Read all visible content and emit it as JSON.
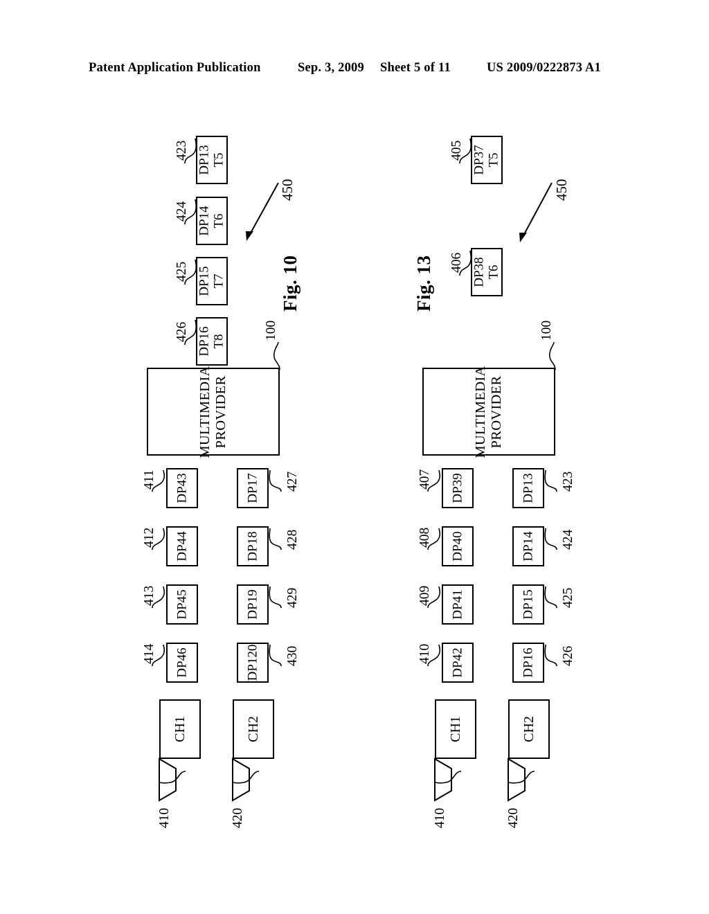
{
  "header": {
    "publication": "Patent Application Publication",
    "date": "Sep. 3, 2009",
    "sheet": "Sheet 5 of 11",
    "patent_number": "US 2009/0222873 A1"
  },
  "figures": [
    {
      "caption": "Fig. 10",
      "provider": {
        "line1": "MULTIMEDIA",
        "line2": "PROVIDER",
        "ref": "100"
      },
      "group_ref": "450",
      "time_boxes": [
        {
          "dp": "DP13",
          "t": "T5",
          "ref": "423"
        },
        {
          "dp": "DP14",
          "t": "T6",
          "ref": "424"
        },
        {
          "dp": "DP15",
          "t": "T7",
          "ref": "425"
        },
        {
          "dp": "DP16",
          "t": "T8",
          "ref": "426"
        }
      ],
      "row1": [
        {
          "dp": "DP43",
          "ref": "411"
        },
        {
          "dp": "DP44",
          "ref": "412"
        },
        {
          "dp": "DP45",
          "ref": "413"
        },
        {
          "dp": "DP46",
          "ref": "414"
        }
      ],
      "row2": [
        {
          "dp": "DP17",
          "ref": "427"
        },
        {
          "dp": "DP18",
          "ref": "428"
        },
        {
          "dp": "DP19",
          "ref": "429"
        },
        {
          "dp": "DP120",
          "ref": "430"
        }
      ],
      "channels": [
        {
          "label": "CH1",
          "ref": "410"
        },
        {
          "label": "CH2",
          "ref": "420"
        }
      ]
    },
    {
      "caption": "Fig. 13",
      "provider": {
        "line1": "MULTIMEDIA",
        "line2": "PROVIDER",
        "ref": "100"
      },
      "group_ref": "450",
      "time_boxes": [
        {
          "dp": "DP37",
          "t": "T5",
          "ref": "405"
        },
        {
          "dp": "DP38",
          "t": "T6",
          "ref": "406"
        }
      ],
      "row1": [
        {
          "dp": "DP39",
          "ref": "407"
        },
        {
          "dp": "DP40",
          "ref": "408"
        },
        {
          "dp": "DP41",
          "ref": "409"
        },
        {
          "dp": "DP42",
          "ref": "410"
        }
      ],
      "row2": [
        {
          "dp": "DP13",
          "ref": "423"
        },
        {
          "dp": "DP14",
          "ref": "424"
        },
        {
          "dp": "DP15",
          "ref": "425"
        },
        {
          "dp": "DP16",
          "ref": "426"
        }
      ],
      "channels": [
        {
          "label": "CH1",
          "ref": "410"
        },
        {
          "label": "CH2",
          "ref": "420"
        }
      ]
    }
  ]
}
